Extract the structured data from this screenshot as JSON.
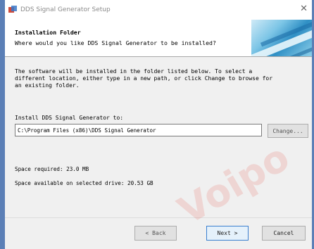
{
  "window": {
    "title": "DDS Signal Generator Setup"
  },
  "header": {
    "title": "Installation Folder",
    "subtitle": "Where would you like DDS Signal Generator to be installed?"
  },
  "body": {
    "lines": [
      "The software will be installed in the folder listed below. To select a",
      "different location, either type in a new path, or click Change to browse for",
      "an existing folder."
    ],
    "install_label": "Install DDS Signal Generator to:",
    "install_path": "C:\\Program Files (x86)\\DDS Signal Generator",
    "change_label": "Change...",
    "space_required": "Space required: 23.0 MB",
    "space_available": "Space available on selected drive: 20.53 GB"
  },
  "buttons": {
    "back": "< Back",
    "next": "Next >",
    "cancel": "Cancel"
  },
  "watermark": "Voipo",
  "colors": {
    "frame": "#5b7fb6",
    "accent": "#3a7fcf"
  }
}
